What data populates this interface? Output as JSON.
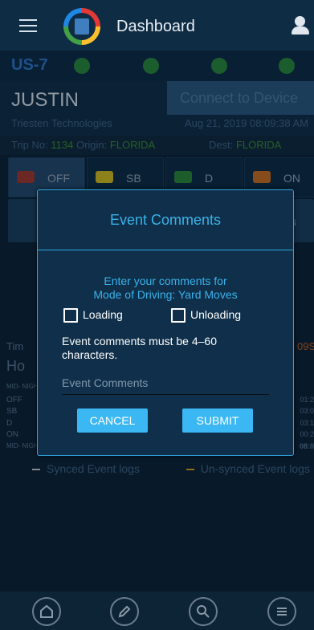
{
  "header": {
    "title": "Dashboard"
  },
  "unit": "US-7",
  "driver": {
    "name": "JUSTIN",
    "company": "Triesten Technologies"
  },
  "connect": {
    "label": "Connect to Device",
    "datetime": "Aug 21, 2019 08:09:38 AM"
  },
  "trip": {
    "label": "Trip No:",
    "number": "1134",
    "origin_label": "Origin:",
    "origin": "FLORIDA",
    "dest_label": "Dest:",
    "dest": "FLORIDA"
  },
  "duty": [
    {
      "label": "OFF"
    },
    {
      "label": "SB"
    },
    {
      "label": "D"
    },
    {
      "label": "ON"
    }
  ],
  "row2": {
    "trailing": "s"
  },
  "time": {
    "label": "Tim",
    "value": "09S"
  },
  "hours": {
    "label": "Ho"
  },
  "graph": {
    "left_labels": [
      "MID- NIGHT",
      "OFF",
      "SB",
      "D",
      "ON",
      "MID- NIGHT"
    ],
    "right_values": [
      "01:2",
      "03:0",
      "03:1",
      "00:2",
      "08:0"
    ]
  },
  "legend": {
    "synced": "Synced Event logs",
    "unsynced": "Un-synced Event logs"
  },
  "dialog": {
    "title": "Event Comments",
    "prompt_line1": "Enter your comments for",
    "prompt_line2": "Mode of Driving: Yard Moves",
    "loading": "Loading",
    "unloading": "Unloading",
    "note": "Event comments must be 4–60 characters.",
    "placeholder": "Event Comments",
    "cancel": "CANCEL",
    "submit": "SUBMIT"
  },
  "colors": {
    "accent": "#3bb2ea",
    "button": "#3bb8f3",
    "green": "#3a8f2e",
    "orange": "#c95f1d"
  }
}
